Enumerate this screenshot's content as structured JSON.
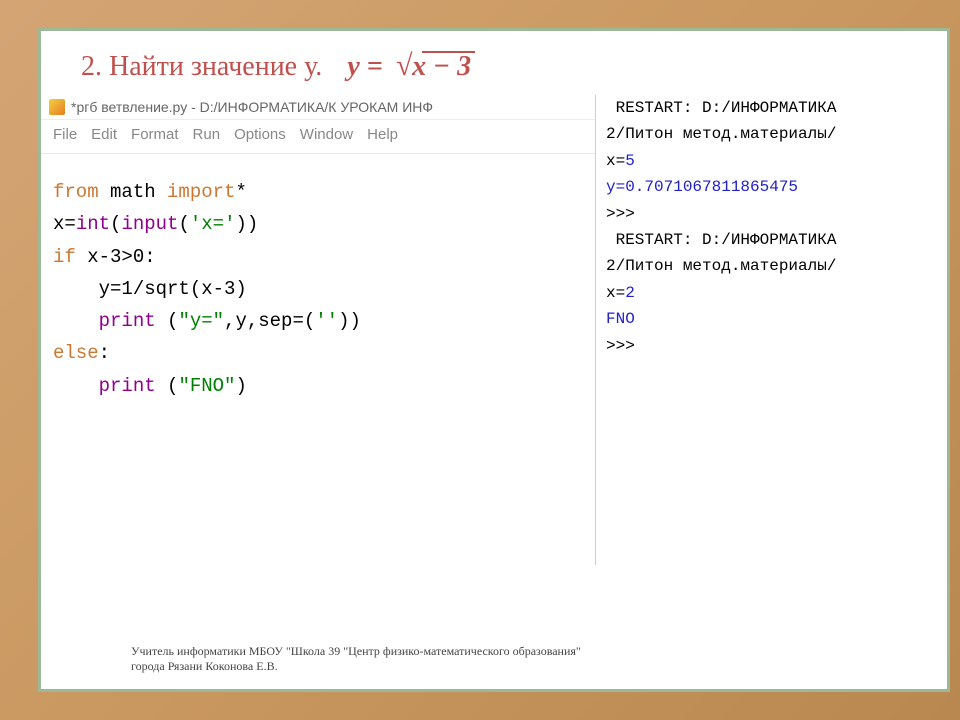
{
  "heading": {
    "number": "2.",
    "text": "Найти значение у.",
    "formula_lhs": "y =",
    "formula_rhs": "x − 3",
    "formula_radical": "√"
  },
  "editor": {
    "titlebar": "*ргб ветвление.ру - D:/ИНФОРМАТИКА/К УРОКАМ ИНФ",
    "menu": {
      "file": "File",
      "edit": "Edit",
      "format": "Format",
      "run": "Run",
      "options": "Options",
      "window": "Window",
      "help": "Help"
    },
    "code": {
      "line1_from": "from",
      "line1_math": " math ",
      "line1_import": "import",
      "line1_star": "*",
      "line2_pre": "x=",
      "line2_int": "int",
      "line2_mid": "(",
      "line2_input": "input",
      "line2_paren": "(",
      "line2_str": "'x='",
      "line2_end": "))",
      "line3_if": "if",
      "line3_cond": " x-3>0:",
      "line4_body": "    y=1/sqrt(x-3)",
      "line5_indent": "    ",
      "line5_print": "print",
      "line5_args": " (",
      "line5_str1": "\"y=\"",
      "line5_mid": ",y,sep=(",
      "line5_str2": "''",
      "line5_end": "))",
      "line6_else": "else",
      "line6_colon": ":",
      "line7_indent": "    ",
      "line7_print": "print",
      "line7_args": " (",
      "line7_str": "\"FNO\"",
      "line7_end": ")"
    }
  },
  "output": {
    "restart1_a": " RESTART: D:/ИНФОРМАТИКА",
    "restart1_b": "2/Питон метод.материалы/",
    "x1_label": "x=",
    "x1_val": "5",
    "y1": "y=0.7071067811865475",
    "prompt1": ">>>",
    "restart2_a": " RESTART: D:/ИНФОРМАТИКА",
    "restart2_b": "2/Питон метод.материалы/",
    "x2_label": "x=",
    "x2_val": "2",
    "fno": "FNO",
    "prompt2": ">>>"
  },
  "footer": {
    "line1": "Учитель информатики МБОУ \"Школа 39 \"Центр физико-математического образования\"",
    "line2": "города Рязани Коконова Е.В."
  }
}
